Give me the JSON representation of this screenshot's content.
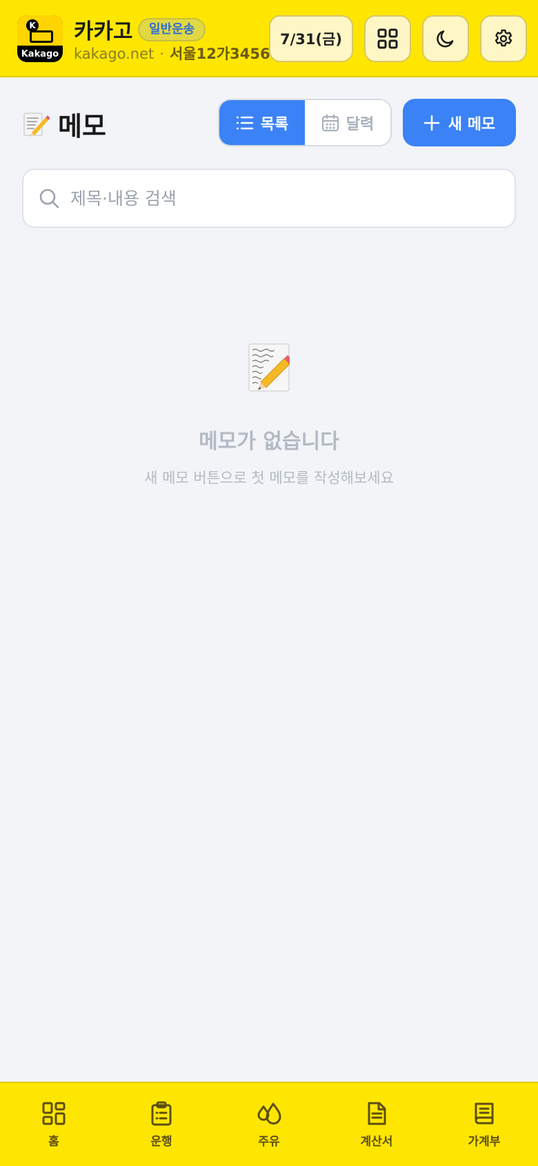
{
  "header": {
    "app_name": "카카고",
    "badge": "일반운송",
    "site": "kakago.net",
    "separator": "·",
    "plate": "서울12가3456",
    "logo_text": "Kakago",
    "logo_letter": "K",
    "date_label": "7/31(금)",
    "icons": [
      "grid-icon",
      "moon-icon",
      "gear-icon"
    ]
  },
  "page": {
    "title": "메모",
    "toggle": {
      "list_label": "목록",
      "calendar_label": "달력",
      "active": "list"
    },
    "new_button_label": "새 메모"
  },
  "search": {
    "placeholder": "제목·내용 검색",
    "value": ""
  },
  "empty_state": {
    "title": "메모가 없습니다",
    "description": "새 메모 버튼으로 첫 메모를 작성해보세요"
  },
  "bottom_nav": {
    "items": [
      {
        "label": "홈",
        "icon": "home-grid-icon"
      },
      {
        "label": "운행",
        "icon": "clipboard-icon"
      },
      {
        "label": "주유",
        "icon": "fuel-drop-icon"
      },
      {
        "label": "계산서",
        "icon": "document-icon"
      },
      {
        "label": "가계부",
        "icon": "ledger-book-icon"
      }
    ]
  },
  "colors": {
    "header_bg": "#ffe600",
    "accent_blue": "#3b82f6",
    "page_bg": "#f2f4f7",
    "muted_text": "#b3bac4"
  }
}
